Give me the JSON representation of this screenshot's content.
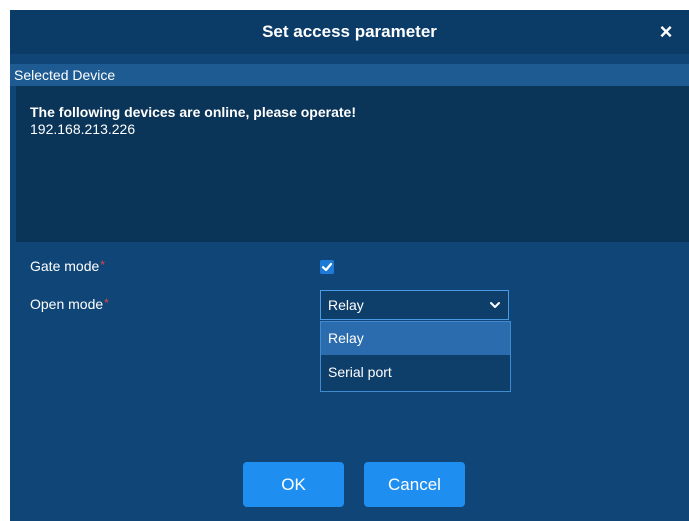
{
  "dialog": {
    "title": "Set access parameter",
    "close_glyph": "×",
    "section_title": "Selected Device",
    "device_message": "The following devices are online, please operate!",
    "device_ip": "192.168.213.226"
  },
  "form": {
    "gate_mode_label": "Gate mode",
    "gate_mode_checked": true,
    "open_mode_label": "Open mode",
    "required_marker": "*",
    "open_mode_value": "Relay",
    "open_mode_options": [
      "Relay",
      "Serial port"
    ],
    "open_mode_highlighted_option": "Relay"
  },
  "buttons": {
    "ok_label": "OK",
    "cancel_label": "Cancel"
  },
  "icons": {
    "close": "close-icon",
    "check": "checkmark-icon",
    "chevron": "chevron-down-icon"
  },
  "colors": {
    "dialog_background": "#0f4677",
    "titlebar_background": "#0b3c68",
    "device_panel_background": "#0a3458",
    "section_header_background": "#1d5b92",
    "accent_button": "#1e8ff0",
    "required_marker": "#e0464c",
    "dropdown_highlight": "#2a6cad"
  }
}
